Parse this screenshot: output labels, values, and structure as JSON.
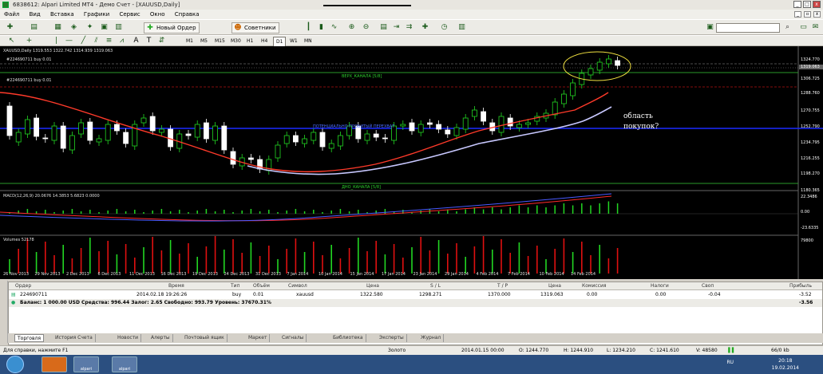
{
  "window": {
    "title": "6838612: Alpari Limited MT4 - Демо Счет - [XAUUSD,Daily]"
  },
  "menu": [
    "Файл",
    "Вид",
    "Вставка",
    "Графики",
    "Сервис",
    "Окно",
    "Справка"
  ],
  "toolbar": {
    "new_order": "Новый Ордер",
    "experts": "Советники",
    "timeframes": [
      "M1",
      "M5",
      "M15",
      "M30",
      "H1",
      "H4",
      "D1",
      "W1",
      "MN"
    ],
    "selected_tf": "D1"
  },
  "chart": {
    "symbol_line": "XAUUSD,Daily  1319.553 1322.742 1314.939 1319.063",
    "buy_line1": "#224690711 buy 0.01",
    "buy_line2": "#224690711 buy 0.01",
    "channel_top": "ВЕРХ_КАНАЛА [5/8]",
    "channel_bottom": "ДНО_КАНАЛА [5/8]",
    "mid_label": "ПОТЕНЦИАЛЬНО ПРОБИТЫЙ ПЕРЕХВАТ",
    "annotation_line1": "область",
    "annotation_line2": "покупок?",
    "prices": [
      "1324.770",
      "1319.063",
      "1306.725",
      "1288.760",
      "1270.755",
      "1252.790",
      "1234.795",
      "1216.255",
      "1198.270",
      "1180.365"
    ],
    "macd_label": "MACD(12,26,9) 20.0676 14.3853 5.6823 0.0000",
    "macd_scale": [
      "22.3486",
      "0.00",
      "-23.6335"
    ],
    "volume_label": "Volumes 52178",
    "volume_scale": "79800",
    "dates": [
      "26 Nov 2013",
      "29 Nov 2013",
      "2 Dec 2013",
      "6 Dec 2013",
      "11 Dec 2013",
      "16 Dec 2013",
      "19 Dec 2013",
      "24 Dec 2013",
      "31 Dec 2013",
      "7 Jan 2014",
      "10 Jan 2014",
      "15 Jan 2014",
      "17 Jan 2014",
      "23 Jan 2014",
      "29 Jan 2014",
      "4 Feb 2014",
      "7 Feb 2014",
      "10 Feb 2014",
      "14 Feb 2014"
    ],
    "colors": {
      "bull": "#22d622",
      "bear": "#ffffff",
      "ma_red": "#ff3a2a",
      "ma_white": "#c8c8ff",
      "channel": "#2a9a2a",
      "mid": "#1a2aff",
      "dashed": "#b01010"
    }
  },
  "terminal": {
    "headers": [
      "Ордер",
      "Время",
      "Тип",
      "Объём",
      "Символ",
      "Цена",
      "S / L",
      "T / P",
      "Цена",
      "Комиссия",
      "Налоги",
      "Своп",
      "Прибыль"
    ],
    "row": [
      "224690711",
      "2014.02.18 19:26:26",
      "buy",
      "0.01",
      "xauusd",
      "1322.580",
      "1298.271",
      "1370.000",
      "1319.063",
      "0.00",
      "0.00",
      "-0.04",
      "-3.52"
    ],
    "balance": "Баланс: 1 000.00 USD  Средства: 996.44  Залог: 2.65  Свободно: 993.79  Уровень: 37670.31%",
    "balance_profit": "-3.56",
    "tabs": [
      "Торговля",
      "История Счета",
      "Новости",
      "Алерты",
      "Почтовый ящик",
      "Маркет",
      "Сигналы",
      "Библиотека",
      "Эксперты",
      "Журнал"
    ]
  },
  "status": {
    "help": "Для справки, нажмите F1",
    "profile": "Золото",
    "date": "2014.01.15 00:00",
    "o": "O: 1244.770",
    "h": "H: 1244.910",
    "l": "L: 1234.210",
    "c": "C: 1241.610",
    "v": "V: 48580",
    "kb": "66/0 kb"
  },
  "taskbar": {
    "items": [
      "",
      "",
      "alpari",
      "alpari"
    ],
    "lang": "RU",
    "time": "20:18",
    "date": "19.02.2014"
  }
}
